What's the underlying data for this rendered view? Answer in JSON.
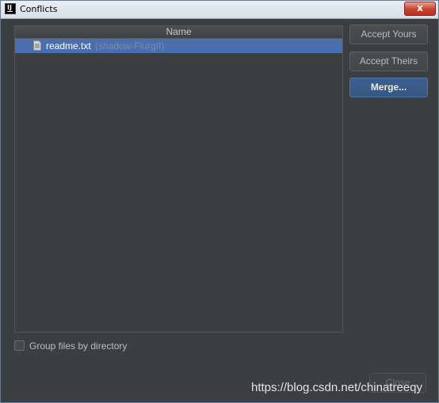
{
  "window": {
    "title": "Conflicts",
    "close_glyph": "x"
  },
  "list": {
    "column_header": "Name",
    "files": [
      {
        "name": "readme.txt",
        "path": "(shadow-FlurgII)"
      }
    ]
  },
  "buttons": {
    "accept_yours": "Accept Yours",
    "accept_theirs": "Accept Theirs",
    "merge": "Merge...",
    "close": "Close"
  },
  "options": {
    "group_by_directory": "Group files by directory",
    "group_by_directory_checked": false
  },
  "watermark": "https://blog.csdn.net/chinatreeqy",
  "colors": {
    "selection": "#4b6eaf",
    "dialog_bg": "#3c3f41",
    "primary_button": "#365880"
  }
}
